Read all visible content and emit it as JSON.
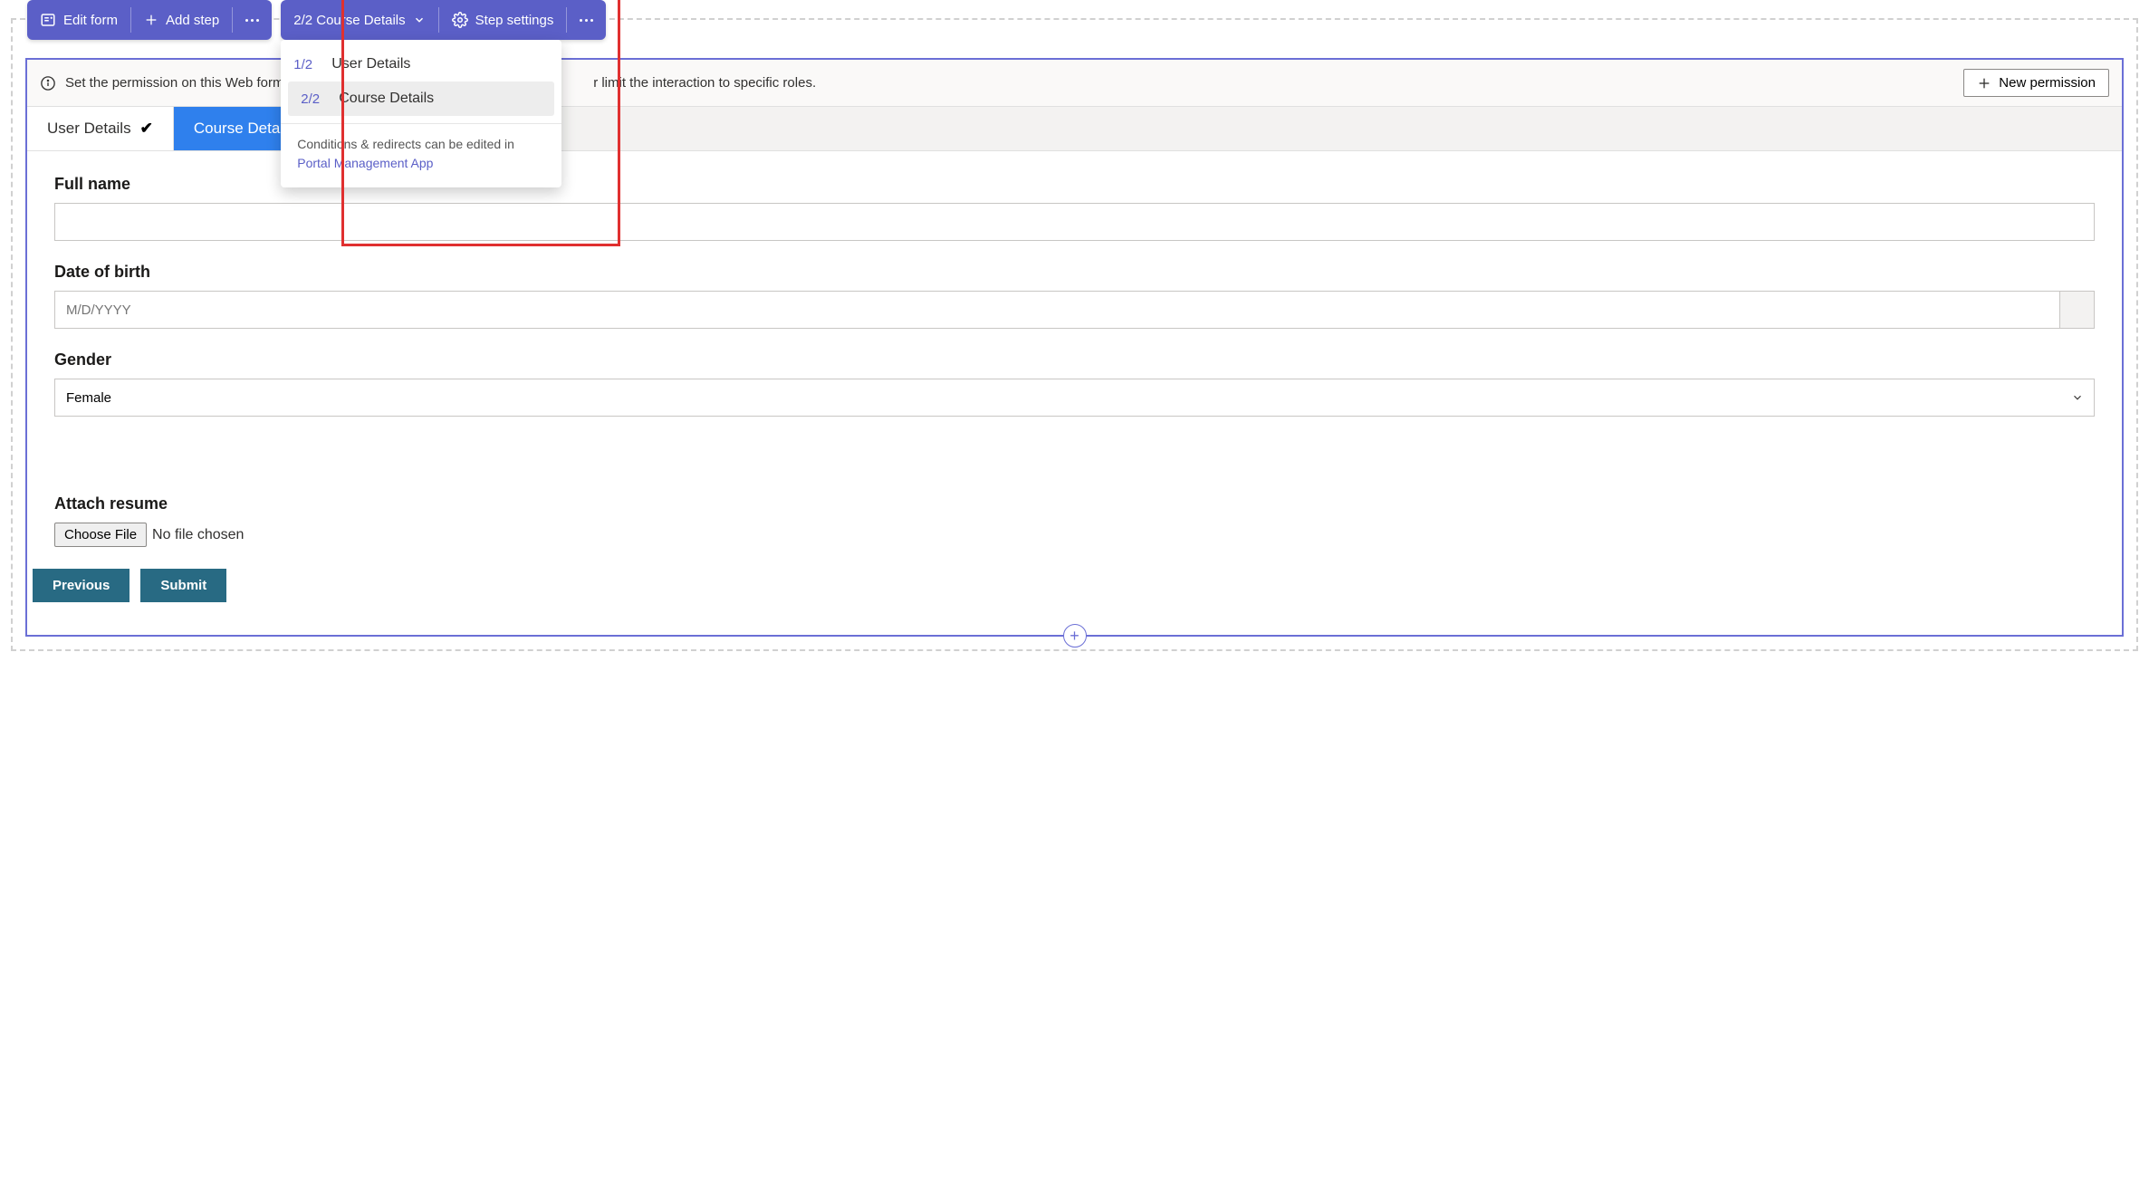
{
  "toolbar1": {
    "edit_form_label": "Edit form",
    "add_step_label": "Add step"
  },
  "toolbar2": {
    "step_selector_label": "2/2 Course Details",
    "step_settings_label": "Step settings"
  },
  "dropdown": {
    "items": [
      {
        "frac": "1/2",
        "label": "User Details"
      },
      {
        "frac": "2/2",
        "label": "Course Details"
      }
    ],
    "footer_text": "Conditions & redirects can be edited in",
    "footer_link": "Portal Management App"
  },
  "alert": {
    "text_left": "Set the permission on this Web form so it ca",
    "text_right": "r limit the interaction to specific roles.",
    "new_permission_label": "New permission"
  },
  "tabs": [
    {
      "label": "User Details",
      "done": true,
      "active": false
    },
    {
      "label": "Course Details",
      "done": false,
      "active": true
    }
  ],
  "form": {
    "full_name": {
      "label": "Full name",
      "value": ""
    },
    "dob": {
      "label": "Date of birth",
      "placeholder": "M/D/YYYY",
      "value": ""
    },
    "gender": {
      "label": "Gender",
      "value": "Female"
    },
    "resume": {
      "label": "Attach resume",
      "button": "Choose File",
      "status": "No file chosen"
    },
    "previous": "Previous",
    "submit": "Submit"
  },
  "add_handle": "+"
}
